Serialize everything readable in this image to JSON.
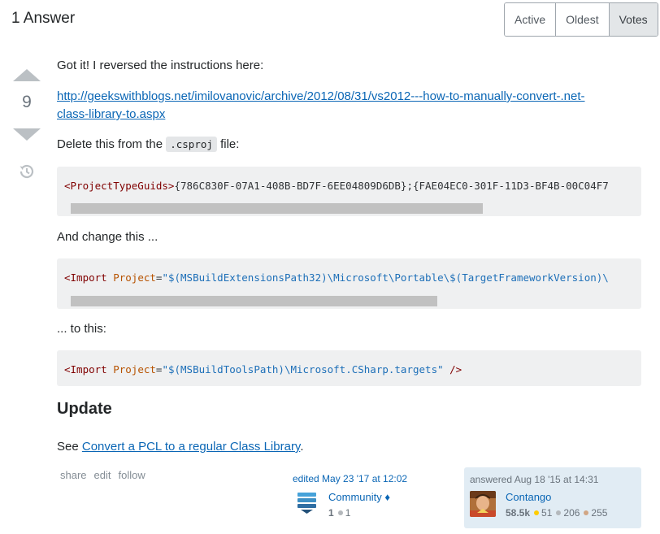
{
  "header": {
    "title": "1 Answer"
  },
  "sort_tabs": [
    {
      "label": "Active"
    },
    {
      "label": "Oldest"
    },
    {
      "label": "Votes"
    }
  ],
  "vote": {
    "count": "9"
  },
  "post": {
    "intro": "Got it! I reversed the instructions here:",
    "link_line1": "http://geekswithblogs.net/imilovanovic/archive/2012/08/31/vs2012---how-to-manually-convert-.net-",
    "link_line2": "class-library-to.aspx",
    "delete_prefix": "Delete this from the",
    "delete_code": ".csproj",
    "delete_suffix": "file:",
    "code1": {
      "tag": "<ProjectTypeGuids>",
      "text": "{786C830F-07A1-408B-BD7F-6EE04809D6DB};{FAE04EC0-301F-11D3-BF4B-00C04F7"
    },
    "change_text": "And change this ...",
    "code2": {
      "tag": "<Import",
      "attr": "Project",
      "eq": "=",
      "value": "\"$(MSBuildExtensionsPath32)\\Microsoft\\Portable\\$(TargetFrameworkVersion)\\"
    },
    "to_text": "... to this:",
    "code3": {
      "tag": "<Import",
      "attr": "Project",
      "eq": "=",
      "value": "\"$(MSBuildToolsPath)\\Microsoft.CSharp.targets\"",
      "close": " />"
    },
    "update_heading": "Update",
    "see_prefix": "See",
    "see_link": "Convert a PCL to a regular Class Library",
    "see_suffix": "."
  },
  "post_menu": {
    "share": "share",
    "edit": "edit",
    "follow": "follow"
  },
  "editor": {
    "edited": "edited May 23 '17 at 12:02",
    "name": "Community",
    "diamond": "♦",
    "rep": "1",
    "bronze": "1"
  },
  "answerer": {
    "answered": "answered Aug 18 '15 at 14:31",
    "name": "Contango",
    "rep": "58.5k",
    "gold": "51",
    "silver": "206",
    "bronze": "255"
  },
  "colors": {
    "link": "#0a66b5",
    "badge_gold": "#ffcc01",
    "badge_silver": "#b4b8bc",
    "badge_bronze": "#d1a684",
    "card_bg": "#e1ecf4"
  }
}
